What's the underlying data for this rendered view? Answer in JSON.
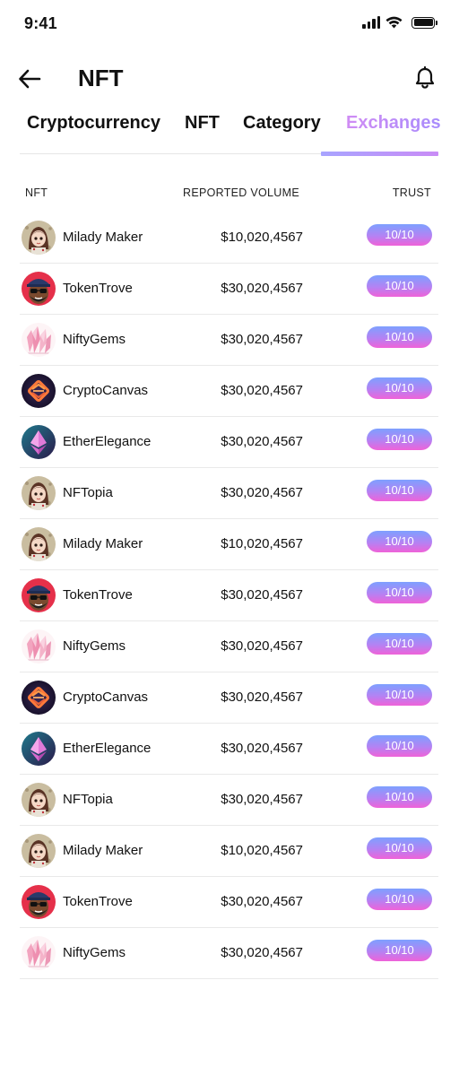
{
  "status_bar": {
    "time": "9:41"
  },
  "header": {
    "title": "NFT",
    "back_icon": "arrow-left-icon",
    "bell_icon": "bell-icon"
  },
  "tabs": [
    {
      "label": "Cryptocurrency",
      "active": false
    },
    {
      "label": "NFT",
      "active": false
    },
    {
      "label": "Category",
      "active": false
    },
    {
      "label": "Exchanges",
      "active": true
    }
  ],
  "table": {
    "columns": {
      "nft": "NFT",
      "volume": "REPORTED VOLUME",
      "trust": "TRUST"
    },
    "rows": [
      {
        "name": "Milady Maker",
        "volume": "$10,020,4567",
        "trust": "10/10",
        "avatar": "milady"
      },
      {
        "name": "TokenTrove",
        "volume": "$30,020,4567",
        "trust": "10/10",
        "avatar": "token"
      },
      {
        "name": "NiftyGems",
        "volume": "$30,020,4567",
        "trust": "10/10",
        "avatar": "gems"
      },
      {
        "name": "CryptoCanvas",
        "volume": "$30,020,4567",
        "trust": "10/10",
        "avatar": "canvas"
      },
      {
        "name": "EtherElegance",
        "volume": "$30,020,4567",
        "trust": "10/10",
        "avatar": "ether"
      },
      {
        "name": "NFTopia",
        "volume": "$30,020,4567",
        "trust": "10/10",
        "avatar": "milady"
      },
      {
        "name": "Milady Maker",
        "volume": "$10,020,4567",
        "trust": "10/10",
        "avatar": "milady"
      },
      {
        "name": "TokenTrove",
        "volume": "$30,020,4567",
        "trust": "10/10",
        "avatar": "token"
      },
      {
        "name": "NiftyGems",
        "volume": "$30,020,4567",
        "trust": "10/10",
        "avatar": "gems"
      },
      {
        "name": "CryptoCanvas",
        "volume": "$30,020,4567",
        "trust": "10/10",
        "avatar": "canvas"
      },
      {
        "name": "EtherElegance",
        "volume": "$30,020,4567",
        "trust": "10/10",
        "avatar": "ether"
      },
      {
        "name": "NFTopia",
        "volume": "$30,020,4567",
        "trust": "10/10",
        "avatar": "milady"
      },
      {
        "name": "Milady Maker",
        "volume": "$10,020,4567",
        "trust": "10/10",
        "avatar": "milady"
      },
      {
        "name": "TokenTrove",
        "volume": "$30,020,4567",
        "trust": "10/10",
        "avatar": "token"
      },
      {
        "name": "NiftyGems",
        "volume": "$30,020,4567",
        "trust": "10/10",
        "avatar": "gems"
      }
    ]
  },
  "colors": {
    "accent_start": "#a8a4ff",
    "accent_end": "#c98cf6",
    "badge_top": "#7ea0ff",
    "badge_bottom": "#ef62d8"
  }
}
